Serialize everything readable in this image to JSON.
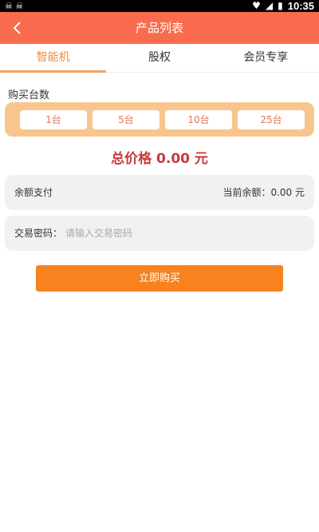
{
  "status_bar": {
    "time": "10:35"
  },
  "header": {
    "title": "产品列表"
  },
  "tabs": [
    {
      "label": "智能机",
      "active": true
    },
    {
      "label": "股权",
      "active": false
    },
    {
      "label": "会员专享",
      "active": false
    }
  ],
  "purchase": {
    "section_label": "购买台数",
    "quantities": [
      "1台",
      "5台",
      "10台",
      "25台"
    ],
    "total_price": "总价格 0.00 元"
  },
  "payment": {
    "method_label": "余额支付",
    "balance_text": "当前余额：0.00  元"
  },
  "password": {
    "label": "交易密码：",
    "placeholder": "请输入交易密码"
  },
  "actions": {
    "buy_label": "立即购买"
  },
  "colors": {
    "header": "#f96b4d",
    "tab_active": "#f38a3a",
    "qty_panel": "#f9c58f",
    "price": "#c73a3a",
    "buy_button": "#f7821f"
  }
}
